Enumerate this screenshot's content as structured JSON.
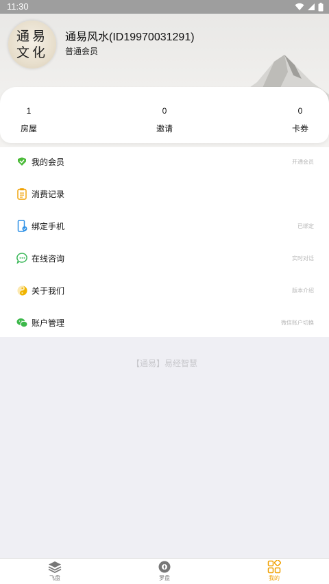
{
  "status_bar": {
    "time": "11:30"
  },
  "profile": {
    "avatar_text": [
      "通易",
      "文化"
    ],
    "name": "通易风水(ID19970031291)",
    "level": "普通会员"
  },
  "stats": [
    {
      "value": "1",
      "label": "房屋"
    },
    {
      "value": "0",
      "label": "邀请"
    },
    {
      "value": "0",
      "label": "卡券"
    }
  ],
  "menu": [
    {
      "label": "我的会员",
      "hint": "开通会员",
      "icon": "vip-check-icon",
      "color": "#4cbb3a"
    },
    {
      "label": "消费记录",
      "hint": "",
      "icon": "receipt-icon",
      "color": "#f0a000"
    },
    {
      "label": "绑定手机",
      "hint": "已绑定",
      "icon": "phone-icon",
      "color": "#2b8fe6"
    },
    {
      "label": "在线咨询",
      "hint": "实时对话",
      "icon": "chat-icon",
      "color": "#3cb85a"
    },
    {
      "label": "关于我们",
      "hint": "版本介绍",
      "icon": "yin-yang-icon",
      "color": "#f0b400"
    },
    {
      "label": "账户管理",
      "hint": "微信账户切换",
      "icon": "wechat-icon",
      "color": "#3cb84a"
    }
  ],
  "slogan": "【通易】易经智慧",
  "tabs": [
    {
      "label": "飞盘",
      "icon": "layers-icon"
    },
    {
      "label": "罗盘",
      "icon": "compass-icon"
    },
    {
      "label": "我的",
      "icon": "grid-icon",
      "active": true
    }
  ],
  "accent_color": "#f0a000"
}
